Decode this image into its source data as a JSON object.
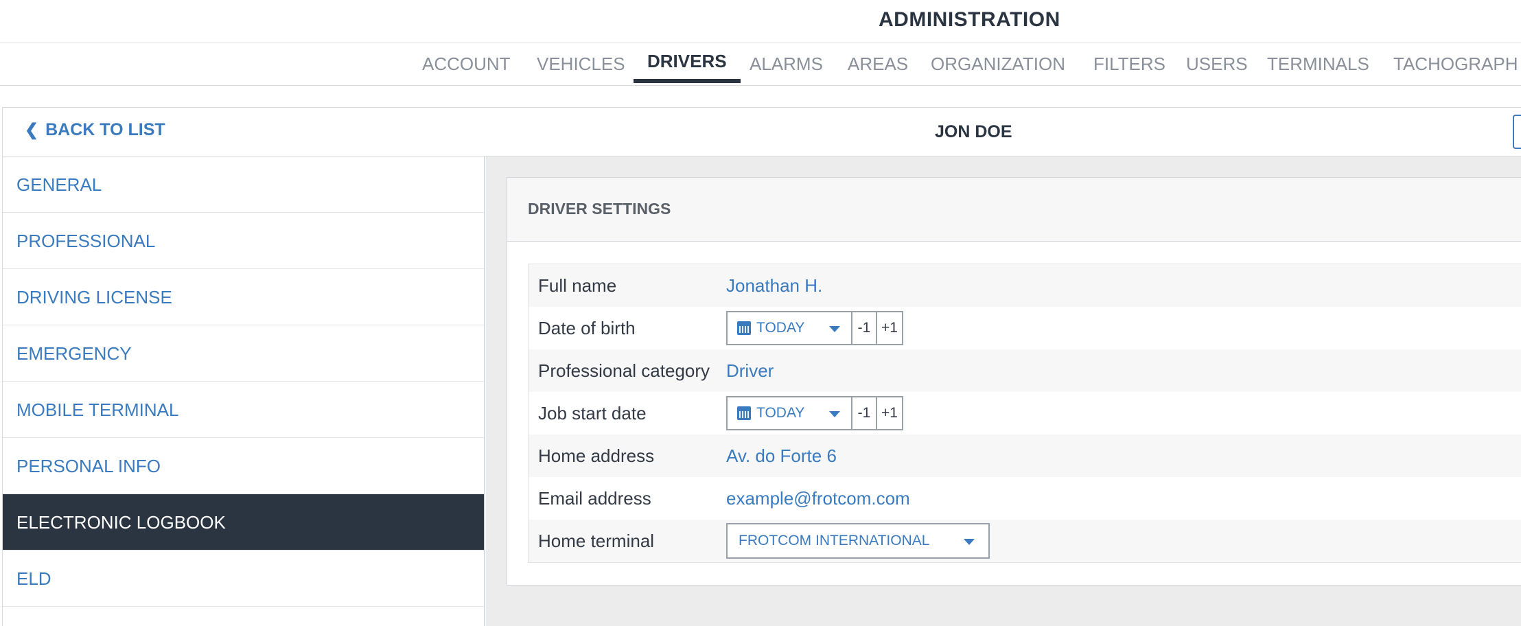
{
  "app": {
    "title": "ADMINISTRATION"
  },
  "nav": {
    "tabs": [
      {
        "label": "ACCOUNT"
      },
      {
        "label": "VEHICLES"
      },
      {
        "label": "DRIVERS",
        "active": true
      },
      {
        "label": "ALARMS"
      },
      {
        "label": "AREAS"
      },
      {
        "label": "ORGANIZATION"
      },
      {
        "label": "FILTERS"
      },
      {
        "label": "USERS"
      },
      {
        "label": "TERMINALS"
      },
      {
        "label": "TACHOGRAPH"
      }
    ]
  },
  "subheader": {
    "back_label": "BACK TO LIST",
    "driver_name": "JON DOE"
  },
  "sidebar": {
    "items": [
      {
        "label": "GENERAL"
      },
      {
        "label": "PROFESSIONAL"
      },
      {
        "label": "DRIVING LICENSE"
      },
      {
        "label": "EMERGENCY"
      },
      {
        "label": "MOBILE TERMINAL"
      },
      {
        "label": "PERSONAL INFO"
      },
      {
        "label": "ELECTRONIC LOGBOOK",
        "active": true
      },
      {
        "label": "ELD"
      }
    ]
  },
  "panel": {
    "title": "DRIVER SETTINGS",
    "fields": {
      "full_name": {
        "label": "Full name",
        "value": "Jonathan H."
      },
      "date_of_birth": {
        "label": "Date of birth",
        "value": "TODAY",
        "minus": "-1",
        "plus": "+1"
      },
      "professional_category": {
        "label": "Professional category",
        "value": "Driver"
      },
      "job_start_date": {
        "label": "Job start date",
        "value": "TODAY",
        "minus": "-1",
        "plus": "+1"
      },
      "home_address": {
        "label": "Home address",
        "value": "Av. do Forte 6"
      },
      "email_address": {
        "label": "Email address",
        "value": "example@frotcom.com"
      },
      "home_terminal": {
        "label": "Home terminal",
        "value": "FROTCOM INTERNATIONAL"
      }
    }
  },
  "colors": {
    "accent": "#3a7bbf",
    "dark": "#2b3542",
    "content_bg": "#ececec"
  },
  "icons": {
    "back": "chevron-left-icon",
    "calendar": "calendar-icon",
    "dropdown": "caret-down-icon"
  }
}
